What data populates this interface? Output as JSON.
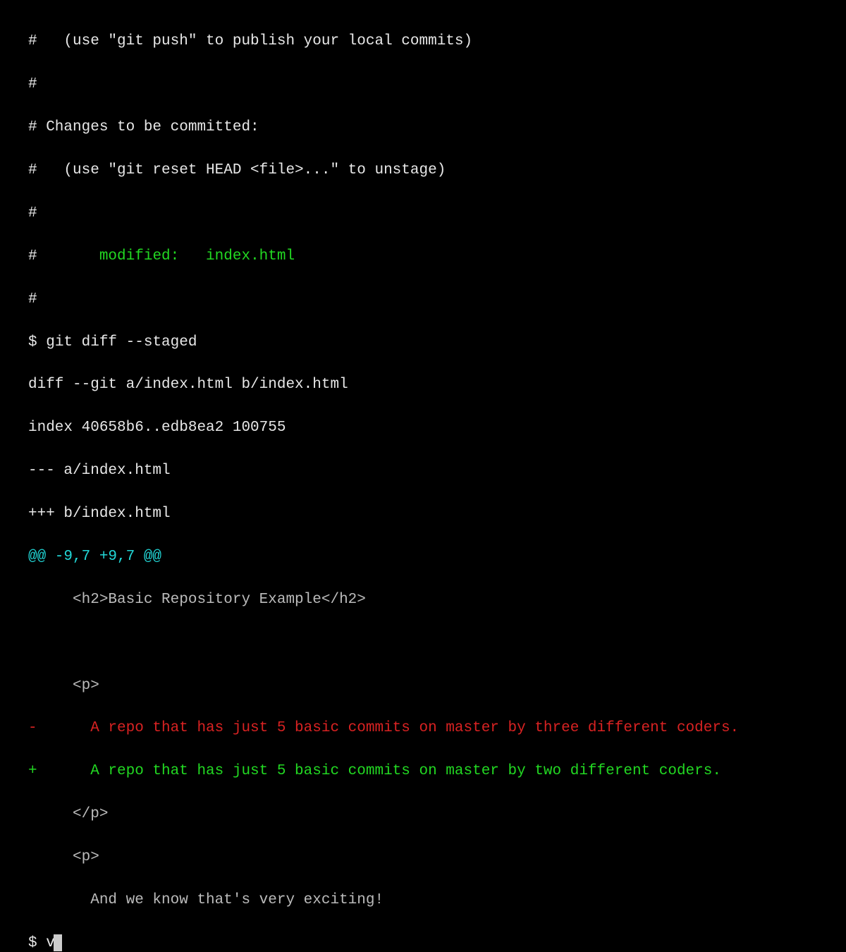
{
  "lines": {
    "l1": "#   (use \"git push\" to publish your local commits)",
    "l2": "#",
    "l3": "# Changes to be committed:",
    "l4": "#   (use \"git reset HEAD <file>...\" to unstage)",
    "l5": "#",
    "l6_prefix": "#       ",
    "l6_green": "modified:   index.html",
    "l7": "#",
    "l8_prompt": "$ ",
    "l8_cmd": "git diff --staged",
    "l9": "diff --git a/index.html b/index.html",
    "l10": "index 40658b6..edb8ea2 100755",
    "l11": "--- a/index.html",
    "l12": "+++ b/index.html",
    "l13": "@@ -9,7 +9,7 @@",
    "l14": "     <h2>Basic Repository Example</h2>",
    "l15": " ",
    "l16": "     <p>",
    "l17": "-      A repo that has just 5 basic commits on master by three different coders.",
    "l18": "+      A repo that has just 5 basic commits on master by two different coders.",
    "l19": "     </p>",
    "l20": "     <p>",
    "l21": "       And we know that's very exciting!",
    "l22_prompt": "$ ",
    "l22_typed": "v"
  }
}
